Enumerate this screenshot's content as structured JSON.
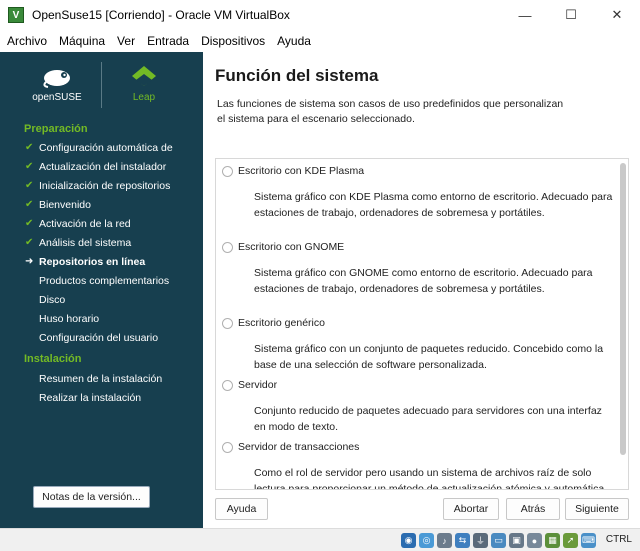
{
  "window": {
    "title": "OpenSuse15 [Corriendo] - Oracle VM VirtualBox",
    "minimize": "—",
    "maximize": "☐",
    "close": "✕"
  },
  "menubar": [
    "Archivo",
    "Máquina",
    "Ver",
    "Entrada",
    "Dispositivos",
    "Ayuda"
  ],
  "sidebar": {
    "logo_left": "openSUSE",
    "logo_right": "Leap",
    "section1": "Preparación",
    "prep_steps": [
      {
        "label": "Configuración automática de",
        "mark": "✔"
      },
      {
        "label": "Actualización del instalador",
        "mark": "✔"
      },
      {
        "label": "Inicialización de repositorios",
        "mark": "✔"
      },
      {
        "label": "Bienvenido",
        "mark": "✔"
      },
      {
        "label": "Activación de la red",
        "mark": "✔"
      },
      {
        "label": "Análisis del sistema",
        "mark": "✔"
      },
      {
        "label": "Repositorios en línea",
        "mark": "➜"
      },
      {
        "label": "Productos complementarios",
        "mark": ""
      },
      {
        "label": "Disco",
        "mark": ""
      },
      {
        "label": "Huso horario",
        "mark": ""
      },
      {
        "label": "Configuración del usuario",
        "mark": ""
      }
    ],
    "section2": "Instalación",
    "install_steps": [
      {
        "label": "Resumen de la instalación"
      },
      {
        "label": "Realizar la instalación"
      }
    ],
    "release_notes": "Notas de la versión..."
  },
  "main": {
    "title": "Función del sistema",
    "intro": "Las funciones de sistema son casos de uso predefinidos que personalizan el sistema para el escenario seleccionado.",
    "options": [
      {
        "name": "Escritorio con KDE Plasma",
        "desc": "Sistema gráfico con KDE Plasma como entorno de escritorio. Adecuado para estaciones de trabajo, ordenadores de sobremesa y portátiles."
      },
      {
        "name": "Escritorio con GNOME",
        "desc": "Sistema gráfico con GNOME como entorno de escritorio. Adecuado para estaciones de trabajo, ordenadores de sobremesa y portátiles."
      },
      {
        "name": "Escritorio genérico",
        "desc": "Sistema gráfico con un conjunto de paquetes reducido. Concebido como la base de una selección de software personalizada."
      },
      {
        "name": "Servidor",
        "desc": "Conjunto reducido de paquetes adecuado para servidores con una interfaz en modo de texto."
      },
      {
        "name": "Servidor de transacciones",
        "desc": "Como el rol de servidor pero usando un sistema de archivos raíz de solo lectura para proporcionar un método de actualización atómica y automática"
      }
    ]
  },
  "buttons": {
    "help": "Ayuda",
    "abort": "Abortar",
    "back": "Atrás",
    "next": "Siguiente"
  },
  "statusbar": {
    "host_key": "CTRL"
  },
  "colors": {
    "sidebar_bg": "#173f4f",
    "accent_green": "#73ba25"
  }
}
